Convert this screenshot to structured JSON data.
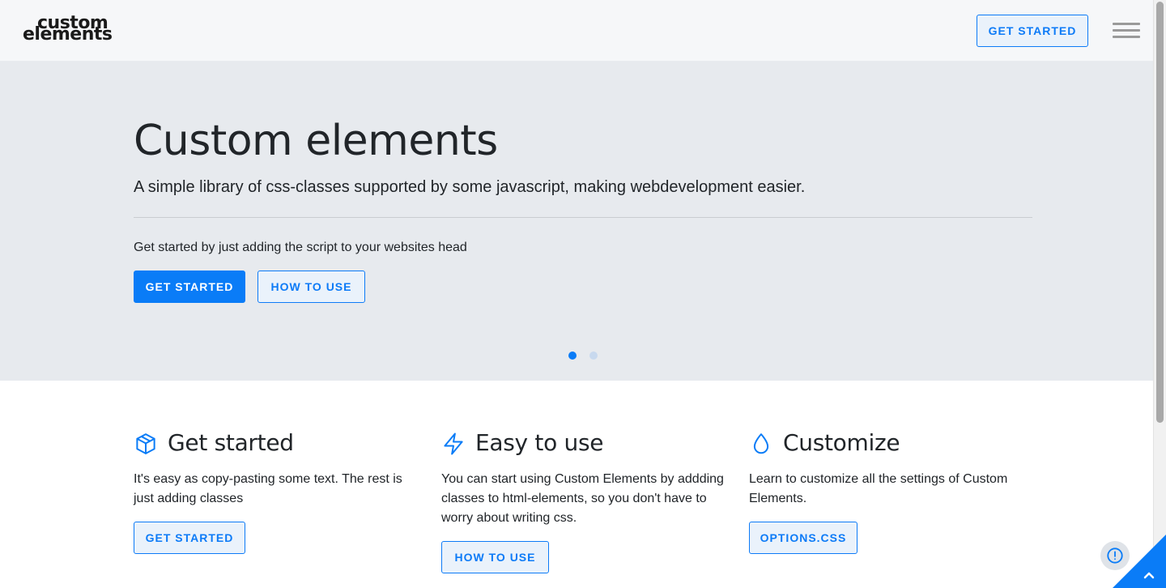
{
  "header": {
    "logo_line1": "custom",
    "logo_line2": "elements",
    "cta_label": "GET STARTED",
    "menu_icon": "hamburger-menu-icon"
  },
  "hero": {
    "title": "Custom elements",
    "subtitle": "A simple library of css-classes supported by some javascript, making webdevelopment easier.",
    "text": "Get started by just adding the script to your websites head",
    "primary_button": "GET STARTED",
    "secondary_button": "HOW TO USE",
    "carousel": {
      "slides": 2,
      "active_index": 0
    }
  },
  "features": [
    {
      "icon": "box-icon",
      "title": "Get started",
      "text": "It's easy as copy-pasting some text. The rest is just adding classes",
      "button": "GET STARTED"
    },
    {
      "icon": "lightning-icon",
      "title": "Easy to use",
      "text": "You can start using Custom Elements by addding classes to html-elements, so you don't have to worry about writing css.",
      "button": "HOW TO USE"
    },
    {
      "icon": "droplet-icon",
      "title": "Customize",
      "text": "Learn to customize all the settings of Custom Elements.",
      "button": "OPTIONS.CSS"
    }
  ],
  "widgets": {
    "feedback_icon": "alert-circle-icon",
    "scroll_top_icon": "chevron-up-icon"
  },
  "colors": {
    "accent": "#0a7cf7",
    "hero_bg": "#e7eaee",
    "header_bg": "#f6f7f9",
    "text": "#212529"
  }
}
